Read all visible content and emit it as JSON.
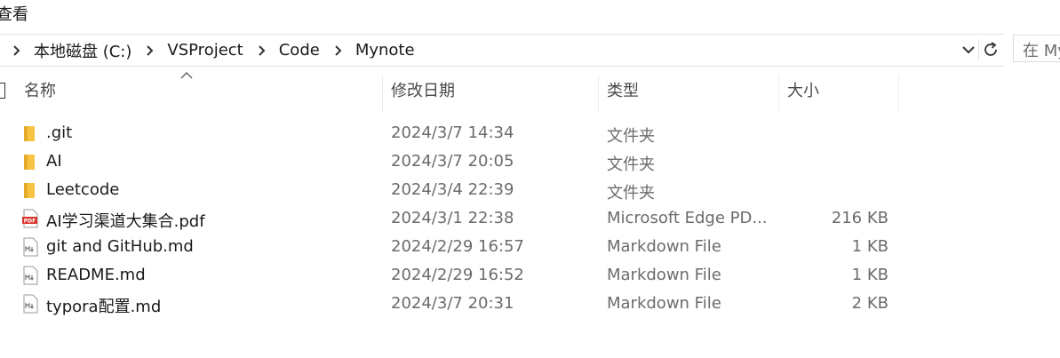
{
  "menu": {
    "view_label": "查看"
  },
  "address_bar": {
    "breadcrumbs": [
      "本地磁盘 (C:)",
      "VSProject",
      "Code",
      "Mynote"
    ]
  },
  "search": {
    "placeholder": "在 My"
  },
  "columns": {
    "name": "名称",
    "date": "修改日期",
    "type": "类型",
    "size": "大小"
  },
  "files": [
    {
      "icon": "folder-icon",
      "name": ".git",
      "date": "2024/3/7 14:34",
      "type": "文件夹",
      "size": ""
    },
    {
      "icon": "folder-icon",
      "name": "AI",
      "date": "2024/3/7 20:05",
      "type": "文件夹",
      "size": ""
    },
    {
      "icon": "folder-icon",
      "name": "Leetcode",
      "date": "2024/3/4 22:39",
      "type": "文件夹",
      "size": ""
    },
    {
      "icon": "pdf-icon",
      "name": "AI学习渠道大集合.pdf",
      "date": "2024/3/1 22:38",
      "type": "Microsoft Edge PD...",
      "size": "216 KB"
    },
    {
      "icon": "markdown-file-icon",
      "name": "git and GitHub.md",
      "date": "2024/2/29 16:57",
      "type": "Markdown File",
      "size": "1 KB"
    },
    {
      "icon": "markdown-file-icon",
      "name": "README.md",
      "date": "2024/2/29 16:52",
      "type": "Markdown File",
      "size": "1 KB"
    },
    {
      "icon": "markdown-file-icon",
      "name": "typora配置.md",
      "date": "2024/3/7 20:31",
      "type": "Markdown File",
      "size": "2 KB"
    }
  ],
  "colors": {
    "folder": "#f6c343",
    "folder_dark": "#e3a92b",
    "pdf_red": "#d9342b"
  }
}
